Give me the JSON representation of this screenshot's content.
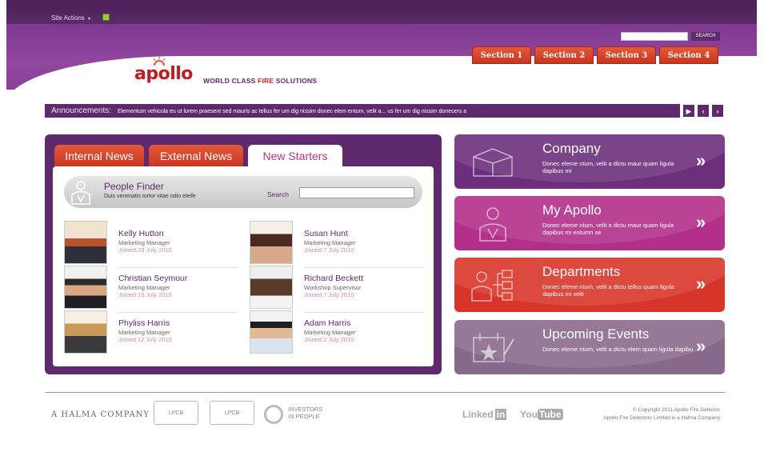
{
  "topbar": {
    "site_actions": "Site Actions",
    "caret": "▾"
  },
  "search": {
    "placeholder": "",
    "button": "SEARCH"
  },
  "nav_tabs": [
    "Section 1",
    "Section 2",
    "Section 3",
    "Section 4"
  ],
  "brand": {
    "logo": "apollo",
    "tagline_prefix": "WORLD CLASS ",
    "tagline_fire": "FIRE",
    "tagline_suffix": " SOLUTIONS"
  },
  "announcements": {
    "label": "Announcements:",
    "text": "Elementum vehicula eu ut lorem praesent sed mauris ac tellus fer um dig nissim donec elem entum, velit a...     us fer um dig nissim donecers a",
    "controls": [
      "▶",
      "‹",
      "›"
    ]
  },
  "news": {
    "tabs": [
      "Internal News",
      "External News",
      "New Starters"
    ],
    "active_tab": "New Starters",
    "people_finder": {
      "title": "People Finder",
      "subtitle": "Duis venenatis tortor vitae odio eleife",
      "search_label": "Search",
      "search_value": ""
    },
    "people": [
      {
        "name": "Kelly Hutton",
        "role": "Marketing Manager",
        "joined": "Joined 29 July 2010"
      },
      {
        "name": "Susan Hunt",
        "role": "Marketing Manager",
        "joined": "Joined 7 July 2010"
      },
      {
        "name": "Christian Seymour",
        "role": "Marketing Manager",
        "joined": "Joined 15 July 2010"
      },
      {
        "name": "Richard Beckett",
        "role": "Workshop Supervisor",
        "joined": "Joined 7 July 2010"
      },
      {
        "name": "Phyliss Harris",
        "role": "Marketing Manager",
        "joined": "Joined 12 July 2010"
      },
      {
        "name": "Adam Harris",
        "role": "Marketing Manager",
        "joined": "Joined 2 July 2010"
      }
    ]
  },
  "tiles": [
    {
      "title": "Company",
      "body": "Donec eleme ntum, velit a dictu maur quam ligula dapibus mi",
      "arrow": "»",
      "color": "#6d2f7c"
    },
    {
      "title": "My Apollo",
      "body": "Donec eleme ntum, velit a dictu maur quam ligula dapibus mi entumn se",
      "arrow": "»",
      "color": "#b22f8a"
    },
    {
      "title": "Departments",
      "body": "Donec eleme ntum, velit a dictu tellus quam ligula dapibus mi velti",
      "arrow": "»",
      "color": "#d7352a"
    },
    {
      "title": "Upcoming Events",
      "body": "Donec eleme ntum, velit a dictu elem quam ligula dapibu",
      "arrow": "»",
      "color": "#8a6a8c"
    }
  ],
  "footer": {
    "halma": "A HALMA COMPANY",
    "lpcb": "LPCB",
    "investors": "INVESTORS\nIN PEOPLE",
    "linkedin": "Linked",
    "linkedin_in": "in",
    "youtube": "You",
    "youtube_tube": "Tube",
    "copyright_line1": "© Copyright 2011 Apollo Fire Detector",
    "copyright_line2": "Apollo Fire Detectors Limited is a Halma Company"
  },
  "colors": {
    "purple": "#5e2a6d",
    "red": "#d7352a",
    "magenta": "#b22f8a"
  }
}
